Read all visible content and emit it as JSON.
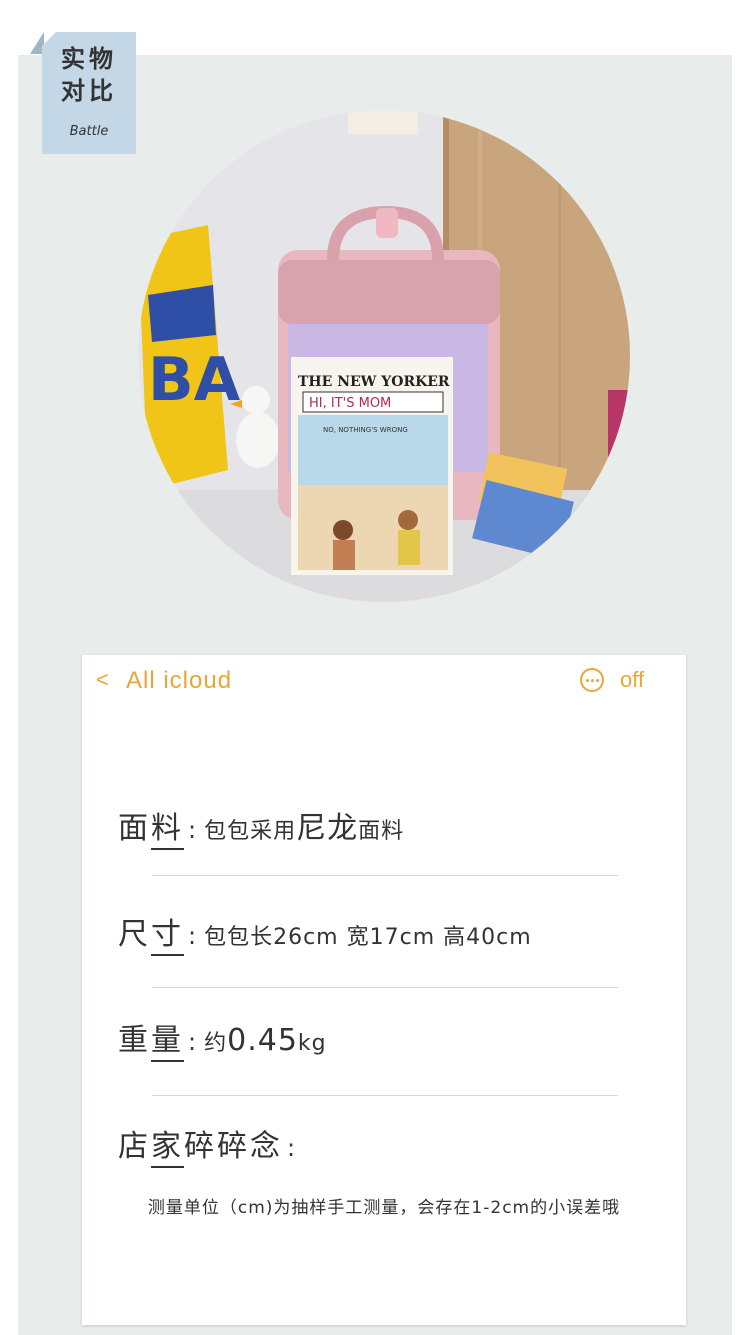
{
  "tag": {
    "line1": "实物",
    "line2": "对比",
    "line3": "Battle"
  },
  "photo": {
    "magazine_title": "THE NEW YORKER",
    "magazine_headline": "HI, IT'S MOM",
    "magazine_banner": "NO, NOTHING'S WRONG",
    "snack_text": "BA"
  },
  "nav": {
    "back_symbol": "<",
    "title": "All icloud",
    "off_label": "off",
    "accent": "#e8a63a"
  },
  "specs": {
    "material": {
      "label_a": "面",
      "label_b": "料",
      "colon": ":",
      "value_a": "包包采用",
      "value_b": "尼龙",
      "value_c": "面料"
    },
    "size": {
      "label_a": "尺",
      "label_b": "寸",
      "colon": ":",
      "value": "包包长26cm 宽17cm 高40cm"
    },
    "weight": {
      "label_a": "重",
      "label_b": "量",
      "colon": ":",
      "value_a": "约",
      "value_b": "0.45",
      "value_c": "kg"
    },
    "notes": {
      "label_a": "店",
      "label_b": "家",
      "label_c": "碎碎念",
      "colon": ":"
    }
  },
  "note": "测量单位（cm)为抽样手工测量，会存在1-2cm的小误差哦",
  "colors": {
    "panel": "#e8ecea",
    "tag": "#c3d7e6",
    "text": "#333333"
  }
}
